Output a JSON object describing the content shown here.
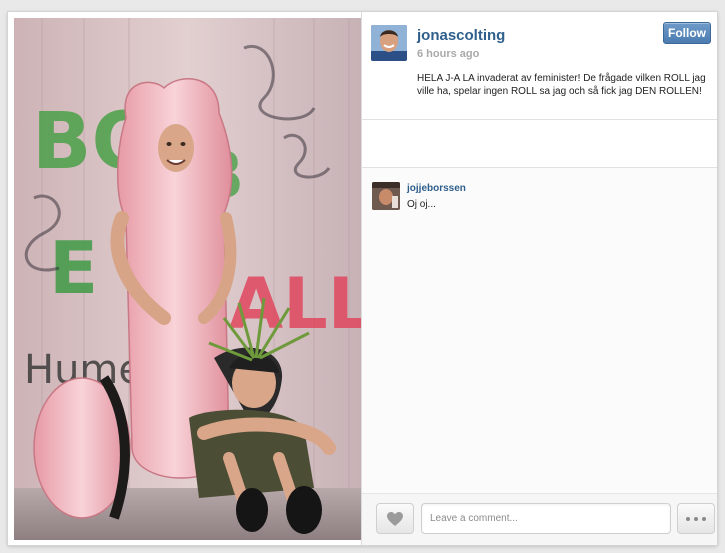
{
  "post": {
    "username": "jonascolting",
    "time": "6 hours ago",
    "follow_label": "Follow",
    "caption": "HELA J-A LA invaderat av feminister! De frågade vilken ROLL jag ville ha, spelar ingen ROLL sa jag och så fick jag DEN ROLLEN!"
  },
  "photo": {
    "graffiti": [
      "BO",
      "B",
      "E",
      "ALL!",
      "Hume"
    ]
  },
  "comments": [
    {
      "username": "jojjeborssen",
      "text": "Oj oj..."
    }
  ],
  "footer": {
    "comment_placeholder": "Leave a comment...",
    "like_icon": "heart-icon",
    "more_icon": "more-dots-icon"
  },
  "colors": {
    "link": "#2f5f8c",
    "follow_button": "#4b7bb0",
    "muted": "#a9a9a9"
  }
}
